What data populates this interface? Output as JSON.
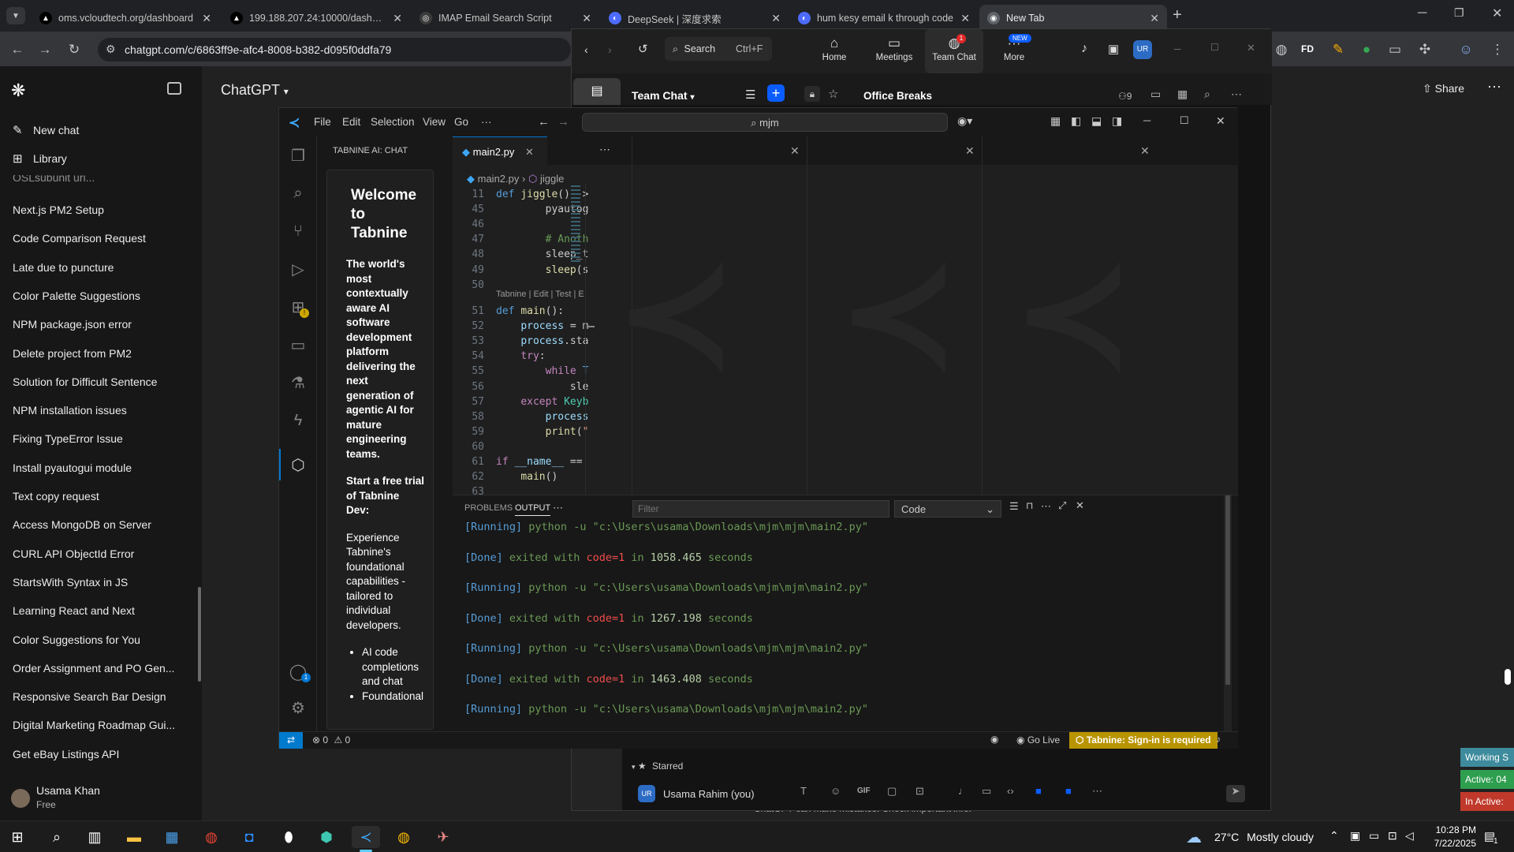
{
  "browser": {
    "tabs": [
      {
        "title": "oms.vcloudtech.org/dashboard",
        "fav": "▲",
        "fav_color": "#000000"
      },
      {
        "title": "199.188.207.24:10000/dashboar",
        "fav": "▲",
        "fav_color": "#000000"
      },
      {
        "title": "IMAP Email Search Script",
        "fav": "◎",
        "fav_color": "#3c3c3c"
      },
      {
        "title": "DeepSeek | 深度求索",
        "fav": "◐",
        "fav_color": "#4d6bfe"
      },
      {
        "title": "hum kesy email k through code",
        "fav": "◐",
        "fav_color": "#4d6bfe"
      },
      {
        "title": "New Tab",
        "fav": "◉",
        "fav_color": "#5f6368"
      }
    ],
    "url": "chatgpt.com/c/6863ff9e-afc4-8008-b382-d095f0ddfa79"
  },
  "chatgpt": {
    "title": "ChatGPT",
    "new_chat": "New chat",
    "library": "Library",
    "truncated_item": "OSLsubunit uri...",
    "history": [
      "Next.js PM2 Setup",
      "Code Comparison Request",
      "Late due to puncture",
      "Color Palette Suggestions",
      "NPM package.json error",
      "Delete project from PM2",
      "Solution for Difficult Sentence",
      "NPM installation issues",
      "Fixing TypeError Issue",
      "Install pyautogui module",
      "Text copy request",
      "Access MongoDB on Server",
      "CURL API ObjectId Error",
      "StartsWith Syntax in JS",
      "Learning React and Next",
      "Color Suggestions for You",
      "Order Assignment and PO Gen...",
      "Responsive Search Bar Design",
      "Digital Marketing Roadmap Gui...",
      "Get eBay Listings API"
    ],
    "user_name": "Usama Khan",
    "user_plan": "Free",
    "share": "Share",
    "disclaimer": "ChatGPT can make mistakes. Check important info."
  },
  "zoom": {
    "search": "Search",
    "search_shortcut": "Ctrl+F",
    "nav": [
      {
        "label": "Home",
        "icon": "⌂"
      },
      {
        "label": "Meetings",
        "icon": "▭"
      },
      {
        "label": "Team Chat",
        "icon": "◍",
        "badge": "1"
      },
      {
        "label": "More",
        "icon": "···",
        "badge": "NEW"
      }
    ],
    "avatar": "UR",
    "team_chat_title": "Team Chat",
    "channel": "Office Breaks",
    "member_count": "9",
    "starred": "Starred",
    "self_user": "Usama Rahim (you)",
    "gif": "GIF"
  },
  "vscode": {
    "menus": [
      "File",
      "Edit",
      "Selection",
      "View",
      "Go",
      "···"
    ],
    "search": "mjm",
    "tabnine_header": "TABNINE AI: CHAT",
    "welcome": "Welcome to Tabnine",
    "tagline": "The world's most contextually aware AI software development platform delivering the next generation of agentic AI for mature engineering teams.",
    "trial": "Start a free trial of Tabnine Dev:",
    "trial_desc": "Experience Tabnine's foundational capabilities - tailored to individual developers.",
    "bullets": [
      "AI code completions and chat",
      "Foundational"
    ],
    "tab": "main2.py",
    "breadcrumb_file": "main2.py",
    "breadcrumb_symbol": "jiggle",
    "codelens": "Tabnine | Edit | Test | E",
    "lines": [
      {
        "n": "11",
        "t": "def jiggle() ->"
      },
      {
        "n": "45",
        "t": "        pyautog"
      },
      {
        "n": "46",
        "t": ""
      },
      {
        "n": "47",
        "t": "        # Anoth"
      },
      {
        "n": "48",
        "t": "        sleep_t"
      },
      {
        "n": "49",
        "t": "        sleep(s"
      },
      {
        "n": "50",
        "t": ""
      },
      {
        "n": "51",
        "t": "def main():"
      },
      {
        "n": "52",
        "t": "    process = m"
      },
      {
        "n": "53",
        "t": "    process.sta"
      },
      {
        "n": "54",
        "t": "    try:"
      },
      {
        "n": "55",
        "t": "        while T"
      },
      {
        "n": "56",
        "t": "            sle"
      },
      {
        "n": "57",
        "t": "    except Keyb"
      },
      {
        "n": "58",
        "t": "        process"
      },
      {
        "n": "59",
        "t": "        print(\""
      },
      {
        "n": "60",
        "t": ""
      },
      {
        "n": "61",
        "t": "if __name__ =="
      },
      {
        "n": "62",
        "t": "    main()"
      },
      {
        "n": "63",
        "t": ""
      }
    ],
    "panel_tabs": [
      "PROBLEMS",
      "OUTPUT"
    ],
    "filter_placeholder": "Filter",
    "output_channel": "Code",
    "output": [
      {
        "k": "running",
        "tag": "[Running]",
        "cmd": "python -u \"c:\\Users\\usama\\Downloads\\mjm\\mjm\\main2.py\""
      },
      {
        "k": "done",
        "tag": "[Done]",
        "pre": "exited with",
        "code": "code=1",
        "in": "in",
        "secs": "1058.465",
        "unit": "seconds"
      },
      {
        "k": "running",
        "tag": "[Running]",
        "cmd": "python -u \"c:\\Users\\usama\\Downloads\\mjm\\mjm\\main2.py\""
      },
      {
        "k": "done",
        "tag": "[Done]",
        "pre": "exited with",
        "code": "code=1",
        "in": "in",
        "secs": "1267.198",
        "unit": "seconds"
      },
      {
        "k": "running",
        "tag": "[Running]",
        "cmd": "python -u \"c:\\Users\\usama\\Downloads\\mjm\\mjm\\main2.py\""
      },
      {
        "k": "done",
        "tag": "[Done]",
        "pre": "exited with",
        "code": "code=1",
        "in": "in",
        "secs": "1463.408",
        "unit": "seconds"
      },
      {
        "k": "running",
        "tag": "[Running]",
        "cmd": "python -u \"c:\\Users\\usama\\Downloads\\mjm\\mjm\\main2.py\""
      }
    ],
    "status_errors": "0",
    "status_warnings": "0",
    "go_live": "Go Live",
    "tabnine_status": "Tabnine: Sign-in is required"
  },
  "side_widget": [
    "Working S",
    "Active: 04",
    "In Active:"
  ],
  "taskbar": {
    "weather_temp": "27°C",
    "weather_desc": "Mostly cloudy",
    "time": "10:28 PM",
    "date": "7/22/2025",
    "notif_count": "1"
  },
  "colors": {
    "vscode_blue": "#007acc",
    "zoom_blue": "#0b5cff",
    "tabnine_status_bg": "#b89500",
    "running": "#569cd6",
    "done": "#6a9955",
    "code_red": "#f14c4c",
    "number_green": "#b5cea8"
  }
}
